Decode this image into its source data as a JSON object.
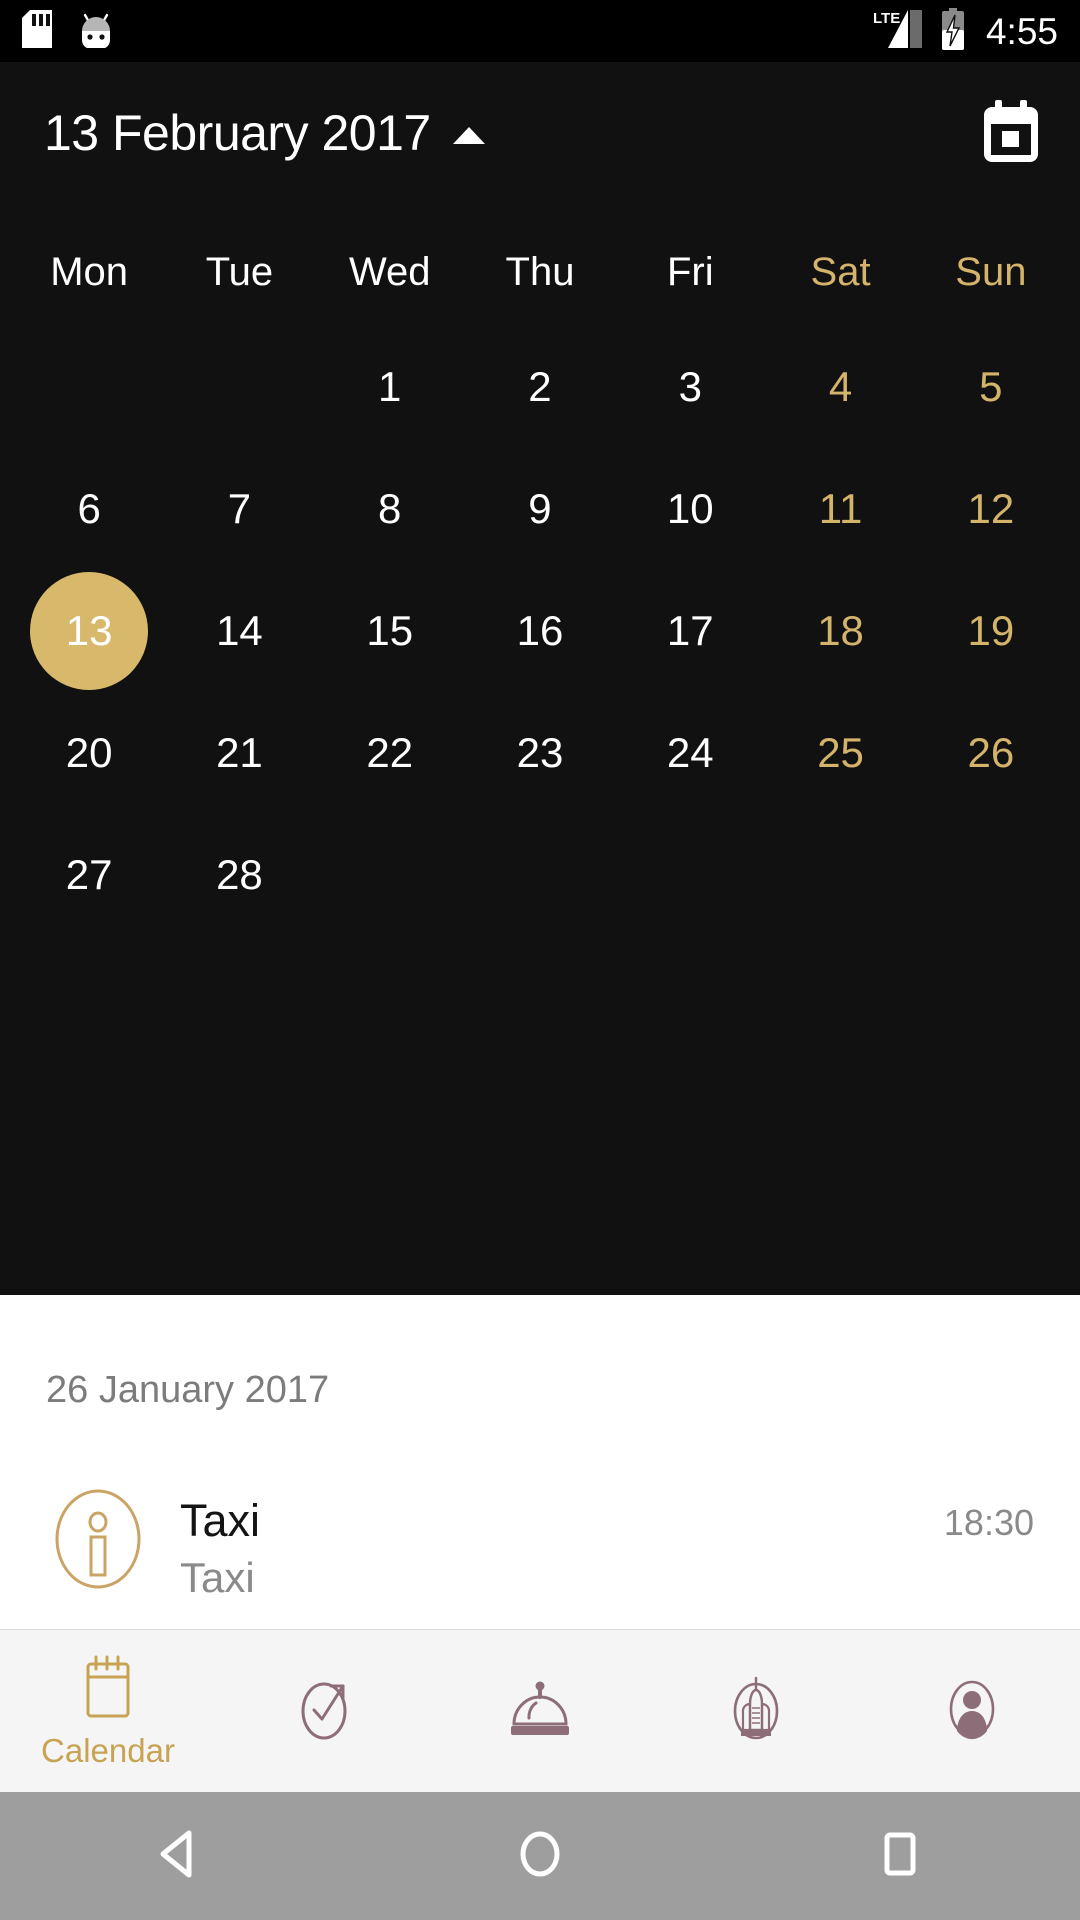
{
  "status_bar": {
    "icons": [
      "sd-card-icon",
      "android-bugdroid-icon"
    ],
    "network_label": "LTE",
    "signal_icon": "signal-bars-icon",
    "battery_icon": "battery-charging-icon",
    "time": "4:55"
  },
  "header": {
    "title": "13 February 2017",
    "collapse_icon": "caret-up-icon",
    "action_icon": "calendar-icon"
  },
  "calendar": {
    "weekdays": [
      {
        "label": "Mon",
        "weekend": false
      },
      {
        "label": "Tue",
        "weekend": false
      },
      {
        "label": "Wed",
        "weekend": false
      },
      {
        "label": "Thu",
        "weekend": false
      },
      {
        "label": "Fri",
        "weekend": false
      },
      {
        "label": "Sat",
        "weekend": true
      },
      {
        "label": "Sun",
        "weekend": true
      }
    ],
    "leading_blanks": 2,
    "days": [
      {
        "n": "1",
        "weekend": false,
        "selected": false
      },
      {
        "n": "2",
        "weekend": false,
        "selected": false
      },
      {
        "n": "3",
        "weekend": false,
        "selected": false
      },
      {
        "n": "4",
        "weekend": true,
        "selected": false
      },
      {
        "n": "5",
        "weekend": true,
        "selected": false
      },
      {
        "n": "6",
        "weekend": false,
        "selected": false
      },
      {
        "n": "7",
        "weekend": false,
        "selected": false
      },
      {
        "n": "8",
        "weekend": false,
        "selected": false
      },
      {
        "n": "9",
        "weekend": false,
        "selected": false
      },
      {
        "n": "10",
        "weekend": false,
        "selected": false
      },
      {
        "n": "11",
        "weekend": true,
        "selected": false
      },
      {
        "n": "12",
        "weekend": true,
        "selected": false
      },
      {
        "n": "13",
        "weekend": false,
        "selected": true
      },
      {
        "n": "14",
        "weekend": false,
        "selected": false
      },
      {
        "n": "15",
        "weekend": false,
        "selected": false
      },
      {
        "n": "16",
        "weekend": false,
        "selected": false
      },
      {
        "n": "17",
        "weekend": false,
        "selected": false
      },
      {
        "n": "18",
        "weekend": true,
        "selected": false
      },
      {
        "n": "19",
        "weekend": true,
        "selected": false
      },
      {
        "n": "20",
        "weekend": false,
        "selected": false
      },
      {
        "n": "21",
        "weekend": false,
        "selected": false
      },
      {
        "n": "22",
        "weekend": false,
        "selected": false
      },
      {
        "n": "23",
        "weekend": false,
        "selected": false
      },
      {
        "n": "24",
        "weekend": false,
        "selected": false
      },
      {
        "n": "25",
        "weekend": true,
        "selected": false
      },
      {
        "n": "26",
        "weekend": true,
        "selected": false
      },
      {
        "n": "27",
        "weekend": false,
        "selected": false
      },
      {
        "n": "28",
        "weekend": false,
        "selected": false
      }
    ]
  },
  "events": {
    "group_date": "26 January 2017",
    "items": [
      {
        "icon": "info-circle-icon",
        "title": "Taxi",
        "subtitle": "Taxi",
        "time": "18:30"
      }
    ]
  },
  "tab_bar": {
    "tabs": [
      {
        "icon": "calendar-icon",
        "label": "Calendar",
        "active": true
      },
      {
        "icon": "check-oval-icon",
        "label": "",
        "active": false
      },
      {
        "icon": "room-service-bell-icon",
        "label": "",
        "active": false
      },
      {
        "icon": "building-icon",
        "label": "",
        "active": false
      },
      {
        "icon": "person-avatar-icon",
        "label": "",
        "active": false
      }
    ]
  },
  "nav_bar": {
    "back_icon": "back-triangle-icon",
    "home_icon": "home-circle-icon",
    "recents_icon": "recents-square-icon"
  },
  "colors": {
    "accent_gold": "#d4b36a",
    "selected_gold": "#d8b86a",
    "tab_active": "#c8a353",
    "tab_inactive": "#8d6e78",
    "panel_dark": "#111111",
    "panel_light": "#ffffff",
    "navbar_gray": "#9e9e9e"
  }
}
